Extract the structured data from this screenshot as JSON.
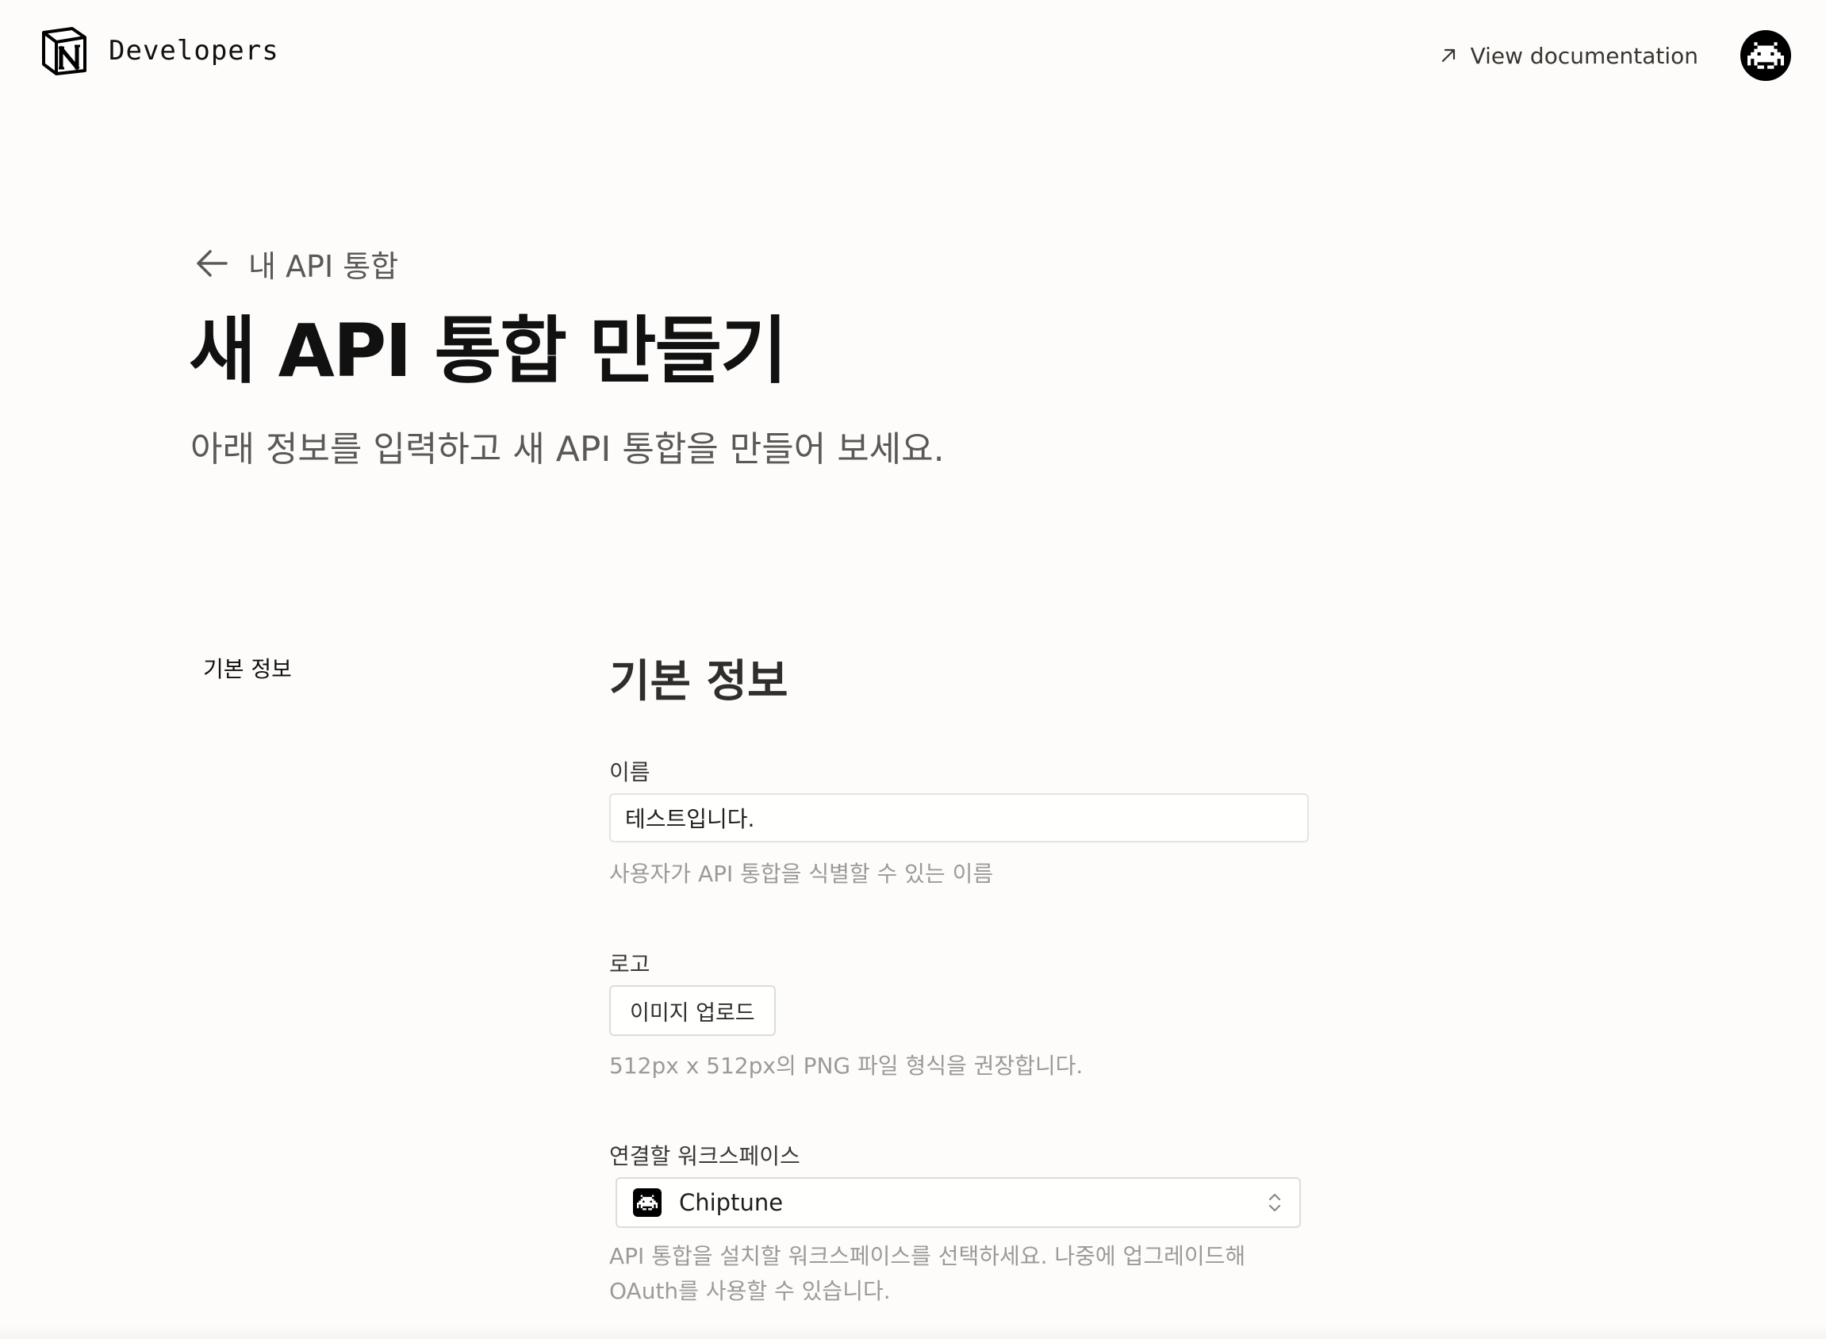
{
  "header": {
    "brand_label": "Developers",
    "doc_link_label": "View documentation"
  },
  "page": {
    "back_label": "내 API 통합",
    "title": "새 API 통합 만들기",
    "subtitle": "아래 정보를 입력하고 새 API 통합을 만들어 보세요."
  },
  "section_nav": {
    "basic_info": "기본 정보"
  },
  "form": {
    "section_title": "기본 정보",
    "name": {
      "label": "이름",
      "value": "테스트입니다.",
      "help": "사용자가 API 통합을 식별할 수 있는 이름"
    },
    "logo": {
      "label": "로고",
      "button_label": "이미지 업로드",
      "help": "512px x 512px의 PNG 파일 형식을 권장합니다."
    },
    "workspace": {
      "label": "연결할 워크스페이스",
      "selected": "Chiptune",
      "help_line1": "API 통합을 설치할 워크스페이스를 선택하세요. 나중에 업그레이드해",
      "help_line2": "OAuth를 사용할 수 있습니다."
    }
  },
  "icons": {
    "brand": "notion-logo-icon",
    "doc_link": "arrow-up-right-icon",
    "avatar": "space-invader-icon",
    "back": "arrow-left-icon",
    "workspace": "space-invader-icon",
    "select": "chevron-up-down-icon"
  },
  "colors": {
    "background": "#fdfcfb",
    "text_primary": "#111111",
    "text_secondary": "#5a5955",
    "text_muted": "#9b9a97",
    "border": "#e5e4e1"
  }
}
